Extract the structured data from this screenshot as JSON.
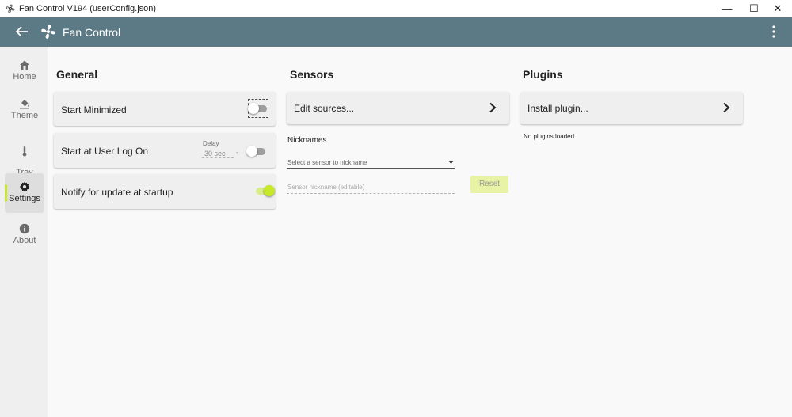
{
  "window": {
    "title": "Fan Control V194 (userConfig.json)",
    "minimize_glyph": "—",
    "maximize_glyph": "☐",
    "close_glyph": "✕"
  },
  "header": {
    "title": "Fan Control"
  },
  "sidebar": {
    "items": [
      {
        "label": "Home",
        "icon": "home-icon"
      },
      {
        "label": "Theme",
        "icon": "paint-bucket-icon"
      },
      {
        "label": "Tray\nIcons",
        "icon": "thermometer-icon"
      },
      {
        "label": "Settings",
        "icon": "gear-icon",
        "active": true
      },
      {
        "label": "About",
        "icon": "info-icon"
      }
    ]
  },
  "general": {
    "title": "General",
    "start_minimized": {
      "label": "Start Minimized",
      "enabled": false
    },
    "start_at_logon": {
      "label": "Start at User Log On",
      "delay_label": "Delay",
      "delay_value": "30 sec",
      "delay_suffix": "-",
      "enabled": false
    },
    "notify_update": {
      "label": "Notify for update at startup",
      "enabled": true
    }
  },
  "sensors": {
    "title": "Sensors",
    "edit_sources_label": "Edit sources...",
    "nicknames_label": "Nicknames",
    "select_placeholder": "Select a sensor to nickname",
    "nickname_placeholder": "Sensor nickname (editable)",
    "reset_label": "Reset"
  },
  "plugins": {
    "title": "Plugins",
    "install_label": "Install plugin...",
    "status": "No plugins loaded"
  },
  "colors": {
    "header_bg": "#5c7986",
    "accent": "#c6e829",
    "sidebar_bg": "#efefef",
    "card_bg": "#efefef"
  }
}
